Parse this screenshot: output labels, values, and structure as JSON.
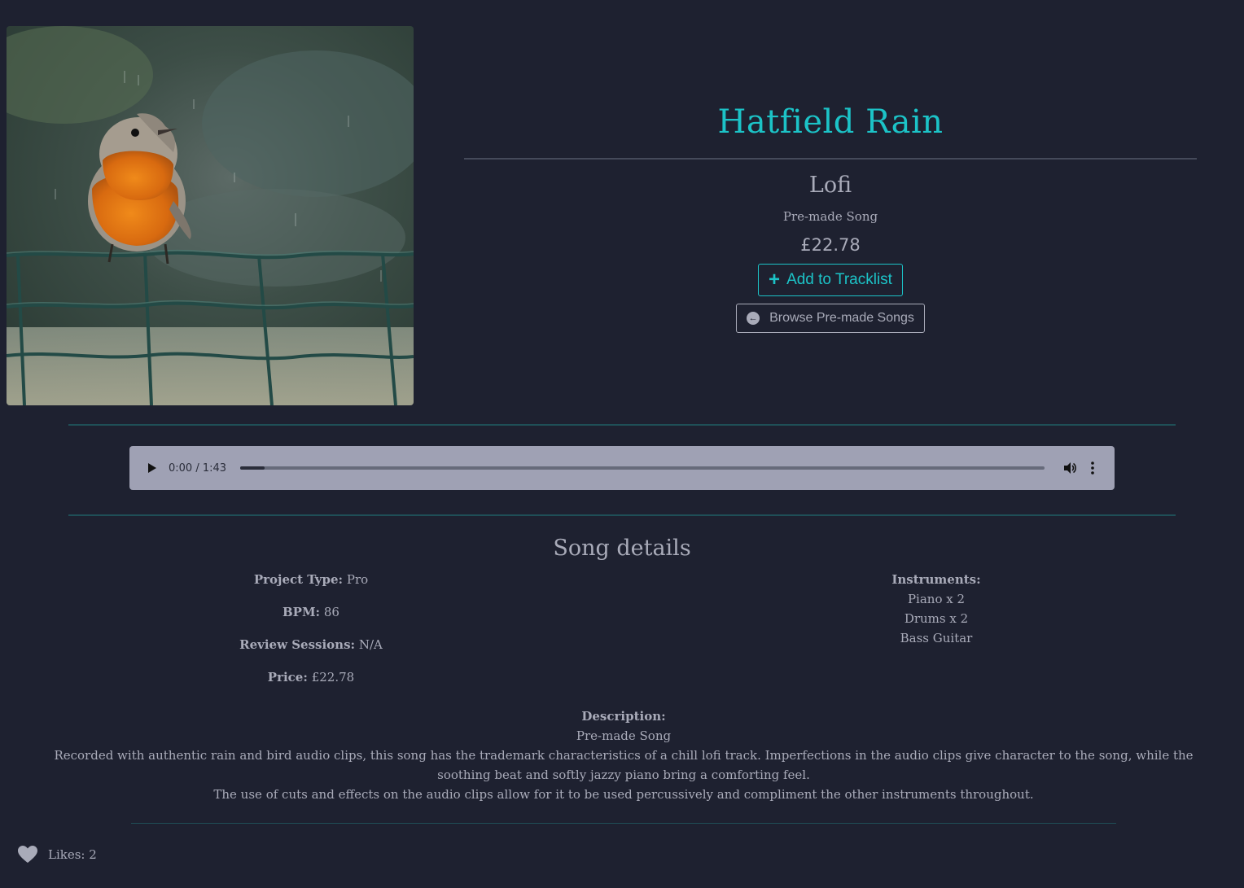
{
  "product": {
    "title": "Hatfield Rain",
    "genre": "Lofi",
    "type": "Pre-made Song",
    "price": "£22.78",
    "add_button_label": "Add to Tracklist",
    "browse_button_label": "Browse Pre-made Songs"
  },
  "player": {
    "time": "0:00 / 1:43",
    "progress": 0.03
  },
  "details": {
    "heading": "Song details",
    "project_type_label": "Project Type:",
    "project_type_value": "Pro",
    "bpm_label": "BPM:",
    "bpm_value": "86",
    "review_sessions_label": "Review Sessions:",
    "review_sessions_value": "N/A",
    "price_label": "Price:",
    "price_value": "£22.78",
    "instruments_label": "Instruments:",
    "instruments": [
      "Piano x 2",
      "Drums x 2",
      "Bass Guitar"
    ]
  },
  "description": {
    "label": "Description:",
    "lines": [
      "Pre-made Song",
      "Recorded with authentic rain and bird audio clips, this song has the trademark characteristics of a chill lofi track. Imperfections in the audio clips give character to the song, while the soothing beat and softly jazzy piano bring a comforting feel.",
      "The use of cuts and effects on the audio clips allow for it to be used percussively and compliment the other instruments throughout."
    ]
  },
  "likes": {
    "text": "Likes: 2"
  },
  "colors": {
    "background": "#1e2130",
    "accent": "#1cc3c7",
    "text": "#a9abb9",
    "player": "#9fa1b4"
  },
  "icons": [
    "plus-icon",
    "back-arrow-icon",
    "play-icon",
    "volume-icon",
    "more-options-icon",
    "heart-icon"
  ]
}
